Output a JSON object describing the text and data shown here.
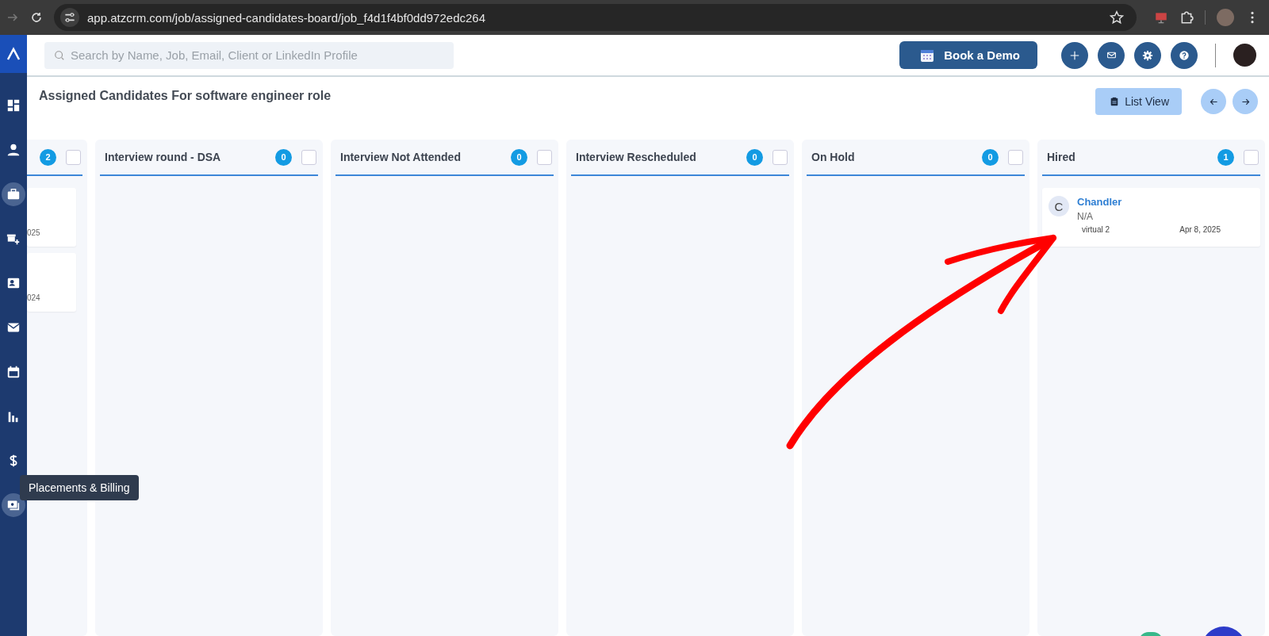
{
  "browser": {
    "url": "app.atzcrm.com/job/assigned-candidates-board/job_f4d1f4bf0dd972edc264"
  },
  "sidebar": {
    "items": [
      {
        "kind": "dashboard",
        "highlighted": false
      },
      {
        "kind": "person",
        "highlighted": false
      },
      {
        "kind": "briefcase",
        "highlighted": true
      },
      {
        "kind": "truck",
        "highlighted": false
      },
      {
        "kind": "contact",
        "highlighted": false
      },
      {
        "kind": "mail",
        "highlighted": false
      },
      {
        "kind": "calendar",
        "highlighted": false
      },
      {
        "kind": "chart",
        "highlighted": false
      },
      {
        "kind": "dollar",
        "highlighted": false
      },
      {
        "kind": "billing",
        "highlighted": true
      }
    ],
    "tooltip": "Placements & Billing"
  },
  "header": {
    "search": {
      "placeholder": "Search by Name, Job, Email, Client or LinkedIn Profile"
    },
    "book_demo": "Book a Demo"
  },
  "page": {
    "title": "Assigned Candidates For software engineer role",
    "list_view": "List View"
  },
  "columns": [
    {
      "kind": "cut",
      "count": "2",
      "checked": false,
      "cards": [
        {
          "date": "025"
        },
        {
          "date": "024"
        }
      ]
    },
    {
      "kind": "full",
      "title": "Interview round - DSA",
      "count": "0",
      "checked": false
    },
    {
      "kind": "full",
      "title": "Interview Not Attended",
      "count": "0",
      "checked": false
    },
    {
      "kind": "full",
      "title": "Interview Rescheduled",
      "count": "0",
      "checked": false
    },
    {
      "kind": "full",
      "title": "On Hold",
      "count": "0",
      "checked": false
    },
    {
      "kind": "full",
      "title": "Hired",
      "count": "1",
      "checked": false,
      "cards": [
        {
          "initial": "C",
          "name": "Chandler",
          "subtitle": "N/A",
          "source": "virtual 2",
          "date": "Apr 8, 2025"
        }
      ]
    }
  ]
}
